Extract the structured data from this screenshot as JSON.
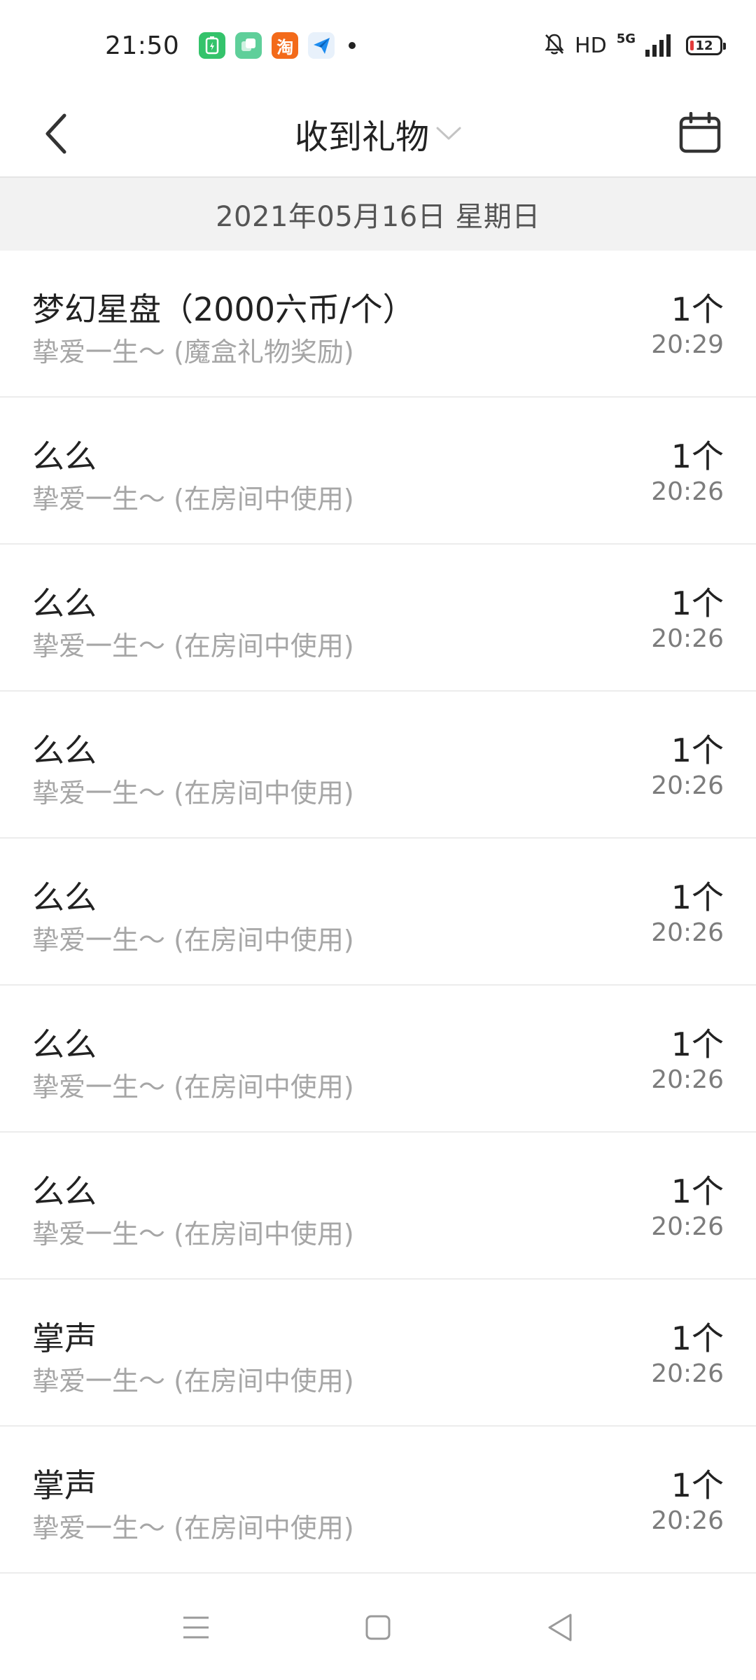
{
  "status_bar": {
    "time": "21:50",
    "app_icons": [
      "battery-saver-icon",
      "cards-app-icon",
      "taobao-icon",
      "plane-app-icon"
    ],
    "taobao_label": "淘",
    "hd": "HD",
    "network": "5G",
    "battery_level": "12",
    "battery_color": "#e23b3b"
  },
  "header": {
    "title": "收到礼物"
  },
  "date_bar": {
    "date": "2021年05月16日 星期日"
  },
  "list": [
    {
      "title": "梦幻星盘（2000六币/个）",
      "subtitle": "挚爱一生～ (魔盒礼物奖励)",
      "count": "1个",
      "time": "20:29"
    },
    {
      "title": "么么",
      "subtitle": "挚爱一生～ (在房间中使用)",
      "count": "1个",
      "time": "20:26"
    },
    {
      "title": "么么",
      "subtitle": "挚爱一生～ (在房间中使用)",
      "count": "1个",
      "time": "20:26"
    },
    {
      "title": "么么",
      "subtitle": "挚爱一生～ (在房间中使用)",
      "count": "1个",
      "time": "20:26"
    },
    {
      "title": "么么",
      "subtitle": "挚爱一生～ (在房间中使用)",
      "count": "1个",
      "time": "20:26"
    },
    {
      "title": "么么",
      "subtitle": "挚爱一生～ (在房间中使用)",
      "count": "1个",
      "time": "20:26"
    },
    {
      "title": "么么",
      "subtitle": "挚爱一生～ (在房间中使用)",
      "count": "1个",
      "time": "20:26"
    },
    {
      "title": "掌声",
      "subtitle": "挚爱一生～ (在房间中使用)",
      "count": "1个",
      "time": "20:26"
    },
    {
      "title": "掌声",
      "subtitle": "挚爱一生～ (在房间中使用)",
      "count": "1个",
      "time": "20:26"
    }
  ],
  "nav_bar": {
    "buttons": [
      "menu-icon",
      "home-icon",
      "back-triangle-icon"
    ]
  }
}
